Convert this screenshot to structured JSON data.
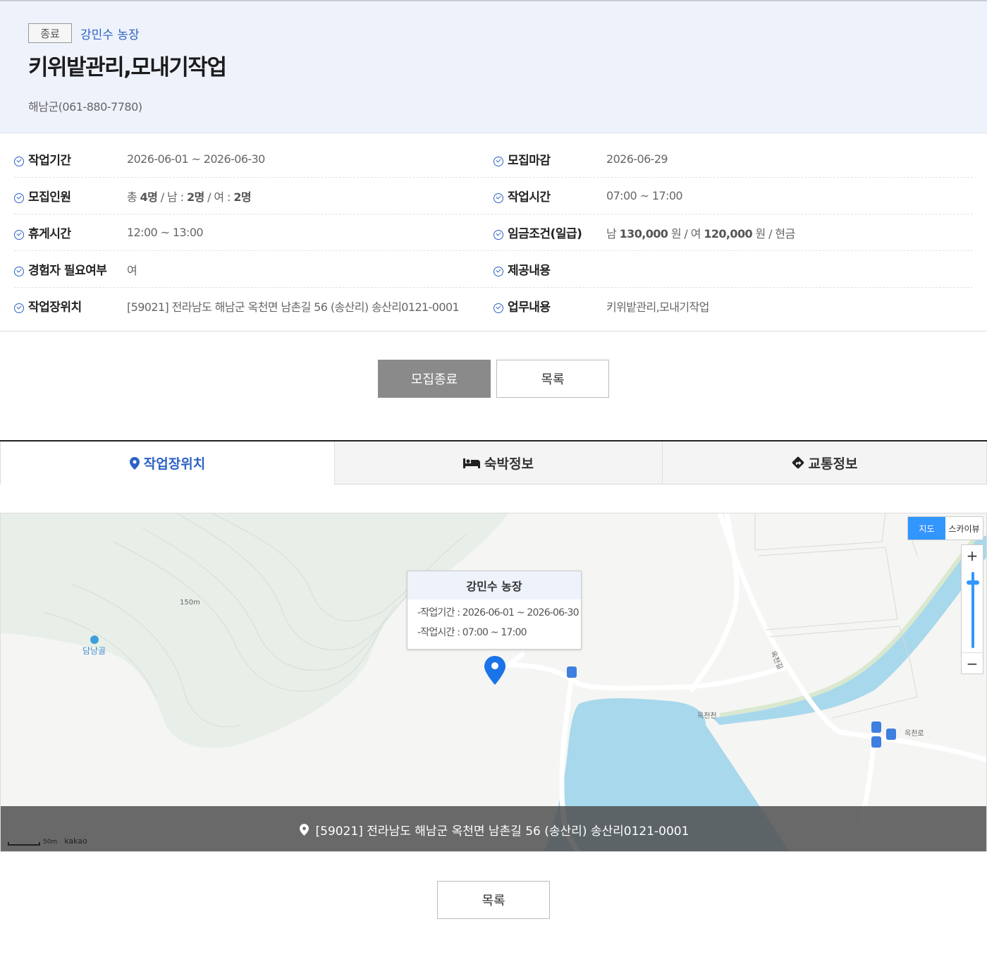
{
  "header": {
    "status_badge": "종료",
    "farm_name": "강민수 농장",
    "title": "키위밭관리,모내기작업",
    "contact": "해남군(061-880-7780)"
  },
  "info": {
    "work_period_label": "작업기간",
    "work_period_value": "2026-06-01 ~ 2026-06-30",
    "deadline_label": "모집마감",
    "deadline_value": "2026-06-29",
    "recruit_label": "모집인원",
    "recruit_total_prefix": "총",
    "recruit_total": "4명",
    "recruit_male_prefix": "/ 남 :",
    "recruit_male": "2명",
    "recruit_female_prefix": "/ 여 :",
    "recruit_female": "2명",
    "work_time_label": "작업시간",
    "work_time_value": "07:00 ~ 17:00",
    "break_label": "휴게시간",
    "break_value": "12:00 ~ 13:00",
    "wage_label": "임금조건(일급)",
    "wage_male_prefix": "남",
    "wage_male": "130,000",
    "wage_male_suffix": "원 / 여",
    "wage_female": "120,000",
    "wage_female_suffix": "원 / 현금",
    "experience_label": "경험자 필요여부",
    "experience_value": "여",
    "provide_label": "제공내용",
    "provide_value": "",
    "location_label": "작업장위치",
    "location_value": "[59021] 전라남도 해남군 옥천면 남촌길 56 (송산리) 송산리0121-0001",
    "task_label": "업무내용",
    "task_value": "키위밭관리,모내기작업"
  },
  "buttons": {
    "closed": "모집종료",
    "list": "목록",
    "list_bottom": "목록"
  },
  "tabs": {
    "location": "작업장위치",
    "lodging": "숙박정보",
    "traffic": "교통정보"
  },
  "map": {
    "toggle_map": "지도",
    "toggle_sky": "스카이뷰",
    "zoom_in": "+",
    "zoom_out": "−",
    "info_title": "강민수 농장",
    "info_period": "-작업기간 : 2026-06-01 ~ 2026-06-30",
    "info_time": "-작업시간 : 07:00 ~ 17:00",
    "label_elevation": "150m",
    "label_place": "담낭골",
    "label_stream": "옥천천",
    "label_road": "옥천로",
    "label_road2": "옥천길",
    "address": "[59021] 전라남도 해남군 옥천면 남촌길 56 (송산리) 송산리0121-0001",
    "scale": "50m",
    "provider": "kakao"
  },
  "colors": {
    "accent": "#2c62c4",
    "header_bg": "#eef2fb",
    "closed_button": "#8a8a8a",
    "map_water": "#a8d8ec",
    "map_toggle_active": "#3396ff"
  }
}
